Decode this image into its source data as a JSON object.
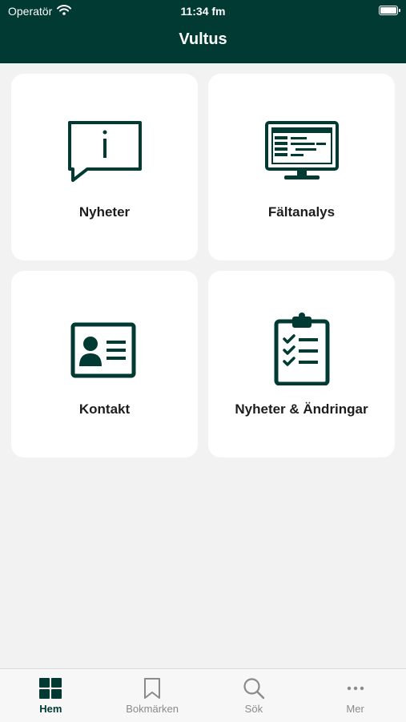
{
  "status_bar": {
    "carrier": "Operatör",
    "time": "11:34 fm"
  },
  "header": {
    "title": "Vultus"
  },
  "tiles": [
    {
      "label": "Nyheter",
      "icon": "info-speech-bubble-icon"
    },
    {
      "label": "Fältanalys",
      "icon": "monitor-data-icon"
    },
    {
      "label": "Kontakt",
      "icon": "contact-card-icon"
    },
    {
      "label": "Nyheter & Ändringar",
      "icon": "clipboard-checklist-icon"
    }
  ],
  "tabbar": {
    "items": [
      {
        "label": "Hem",
        "icon": "grid-icon",
        "active": true
      },
      {
        "label": "Bokmärken",
        "icon": "bookmark-icon",
        "active": false
      },
      {
        "label": "Sök",
        "icon": "search-icon",
        "active": false
      },
      {
        "label": "Mer",
        "icon": "more-icon",
        "active": false
      }
    ]
  },
  "colors": {
    "primary": "#003a33",
    "background": "#f2f2f2",
    "tile": "#ffffff",
    "inactive": "#8a8a8a"
  }
}
